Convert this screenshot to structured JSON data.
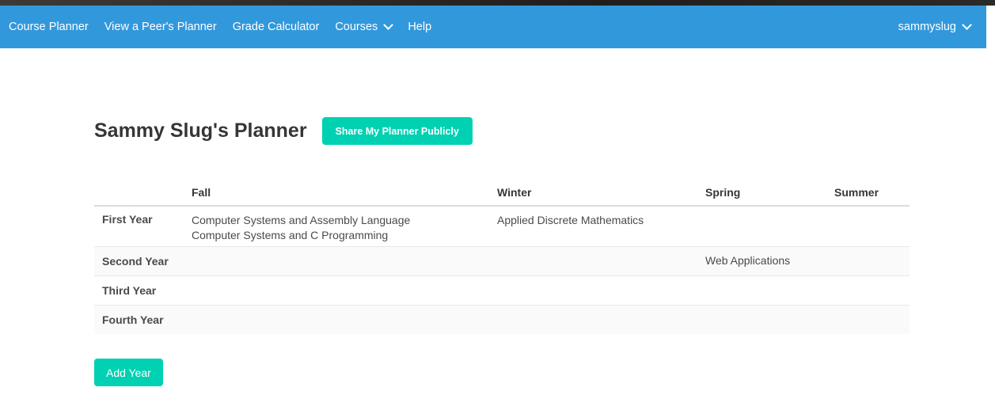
{
  "nav": {
    "items": [
      {
        "label": "Course Planner"
      },
      {
        "label": "View a Peer's Planner"
      },
      {
        "label": "Grade Calculator"
      },
      {
        "label": "Courses"
      },
      {
        "label": "Help"
      }
    ],
    "user": "sammyslug",
    "colors": {
      "navbar": "#3298dc",
      "accent": "#00d1b2"
    }
  },
  "page": {
    "title": "Sammy Slug's Planner",
    "share_label": "Share My Planner Publicly",
    "add_year_label": "Add Year"
  },
  "table": {
    "headers": [
      "",
      "Fall",
      "Winter",
      "Spring",
      "Summer"
    ],
    "rows": [
      {
        "year": "First Year",
        "fall": [
          "Computer Systems and Assembly Language",
          "Computer Systems and C Programming"
        ],
        "winter": [
          "Applied Discrete Mathematics"
        ],
        "spring": [],
        "summer": []
      },
      {
        "year": "Second Year",
        "fall": [],
        "winter": [],
        "spring": [
          "Web Applications"
        ],
        "summer": []
      },
      {
        "year": "Third Year",
        "fall": [],
        "winter": [],
        "spring": [],
        "summer": []
      },
      {
        "year": "Fourth Year",
        "fall": [],
        "winter": [],
        "spring": [],
        "summer": []
      }
    ]
  }
}
